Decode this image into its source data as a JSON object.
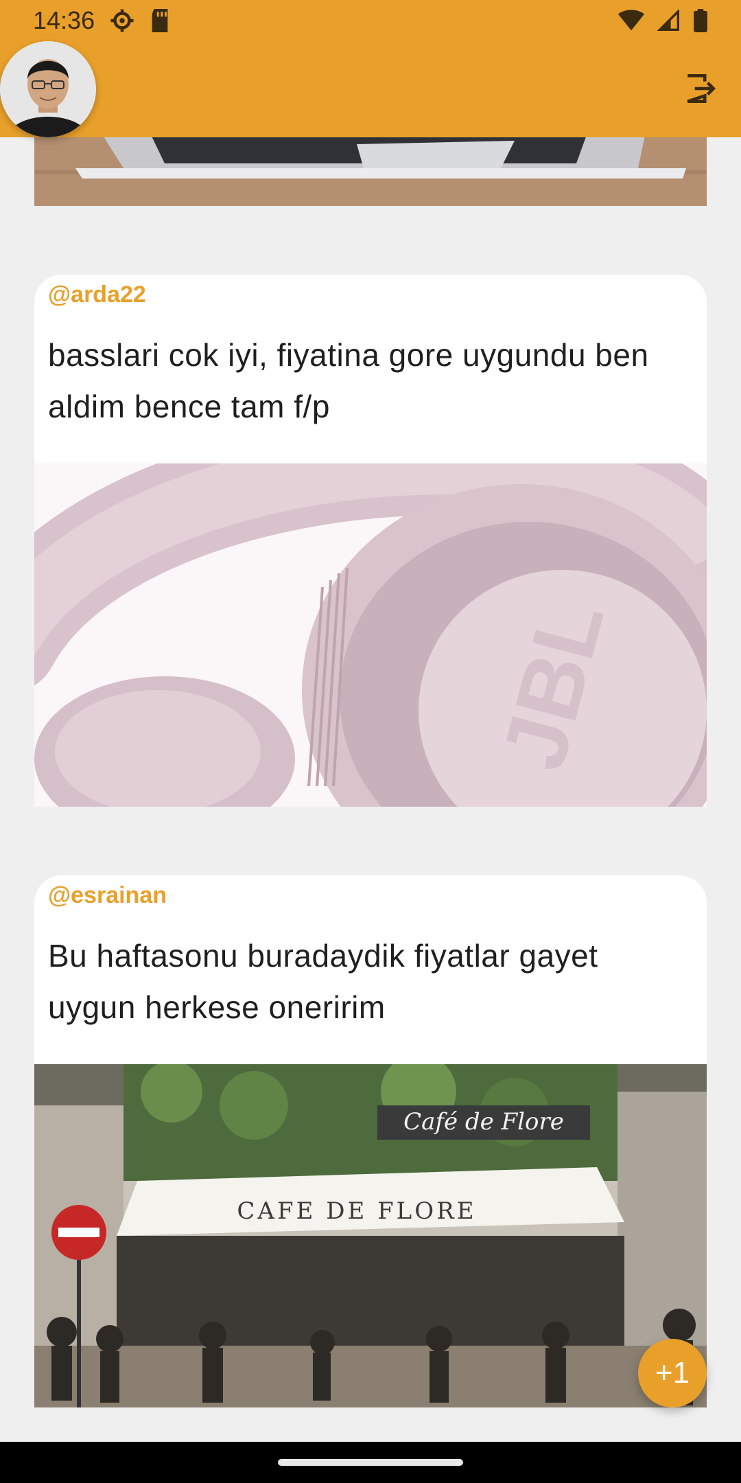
{
  "status_bar": {
    "time": "14:36",
    "icons": [
      "settings-gear-icon",
      "sd-card-icon",
      "wifi-icon",
      "cell-signal-icon",
      "battery-icon"
    ]
  },
  "app_bar": {
    "background_color": "#e9a02a",
    "avatar_icon": "user-avatar",
    "logout_icon": "logout-icon"
  },
  "posts": [
    {
      "author": "@arda22",
      "text": "basslari cok iyi, fiyatina gore uygundu ben aldim bence tam f/p",
      "image_icon": "pink-headphones-photo"
    },
    {
      "author": "@esrainan",
      "text": "Bu haftasonu buradaydik fiyatlar gayet uygun herkese oneririm",
      "image_icon": "cafe-de-flore-photo",
      "sign_text": "CAFE DE FLORE",
      "script_text": "Café de Flore"
    }
  ],
  "fab": {
    "label": "+1"
  }
}
